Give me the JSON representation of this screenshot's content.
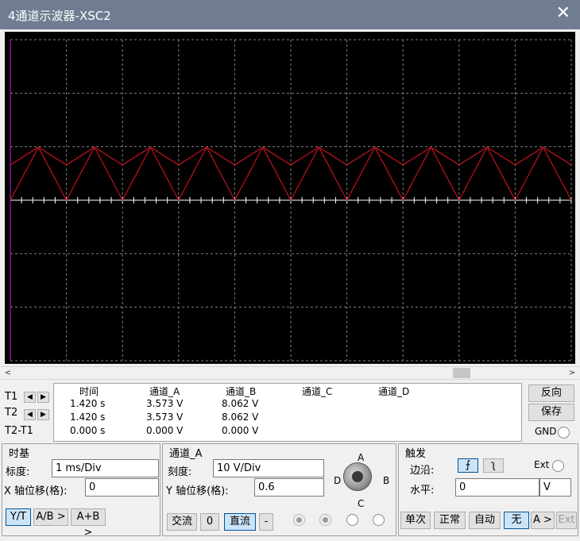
{
  "window": {
    "title": "4通道示波器-XSC2",
    "close_glyph": "✕"
  },
  "scope": {
    "background": "#000000",
    "grid_color": "#7f7f7f",
    "trace_color": "#b4121b",
    "divisions_x": 10,
    "divisions_y": 6
  },
  "chart_data": {
    "type": "line",
    "xlabel": "",
    "ylabel": "",
    "grid": true,
    "series": [
      {
        "values": [
          0.6,
          0.9,
          0.6,
          0.9,
          0.6,
          0.9,
          0.6,
          0.9,
          0.6,
          0.9,
          0.6,
          0.9,
          0.6,
          0.9,
          0.6,
          0.9,
          0.6,
          0.9,
          0.6,
          0.9,
          0.6
        ]
      },
      {
        "values": [
          0.0,
          0.9,
          0.0,
          0.9,
          0.0,
          0.9,
          0.0,
          0.9,
          0.0,
          0.9,
          0.0,
          0.9,
          0.0,
          0.9,
          0.0,
          0.9,
          0.0,
          0.9,
          0.0,
          0.9,
          0.0
        ]
      }
    ]
  },
  "scrollbar": {
    "left_arrow": "<",
    "right_arrow": ">"
  },
  "cursors": {
    "t1": "T1",
    "t2": "T2",
    "t2t1": "T2-T1",
    "arrow_left": "◀",
    "arrow_right": "▶",
    "headers": [
      "时间",
      "通道_A",
      "通道_B",
      "通道_C",
      "通道_D"
    ],
    "rows": [
      [
        "1.420 s",
        "3.573 V",
        "8.062 V"
      ],
      [
        "1.420 s",
        "3.573 V",
        "8.062 V"
      ],
      [
        "0.000 s",
        "0.000 V",
        "0.000 V"
      ]
    ]
  },
  "right_buttons": {
    "reverse": "反向",
    "save": "保存",
    "gnd": "GND"
  },
  "timebase": {
    "title": "时基",
    "scale_label": "标度:",
    "scale_value": "1 ms/Div",
    "xpos_label": "X 轴位移(格):",
    "xpos_value": "0",
    "modes": [
      "Y/T",
      "A/B >",
      "A+B >"
    ]
  },
  "channel": {
    "title": "通道_A",
    "scale_label": "刻度:",
    "scale_value": "10  V/Div",
    "ypos_label": "Y 轴位移(格):",
    "ypos_value": "0.6",
    "coupling": [
      "交流",
      "0",
      "直流",
      "-"
    ],
    "knob_labels": {
      "a": "A",
      "b": "B",
      "c": "C",
      "d": "D"
    }
  },
  "trigger": {
    "title": "触发",
    "edge_label": "边沿:",
    "edge_rise": "⨍",
    "edge_fall": "ʅ",
    "ext_label": "Ext",
    "level_label": "水平:",
    "level_value": "0",
    "level_unit": "V",
    "modes": [
      "单次",
      "正常",
      "自动",
      "无",
      "A >",
      "Ext"
    ]
  }
}
